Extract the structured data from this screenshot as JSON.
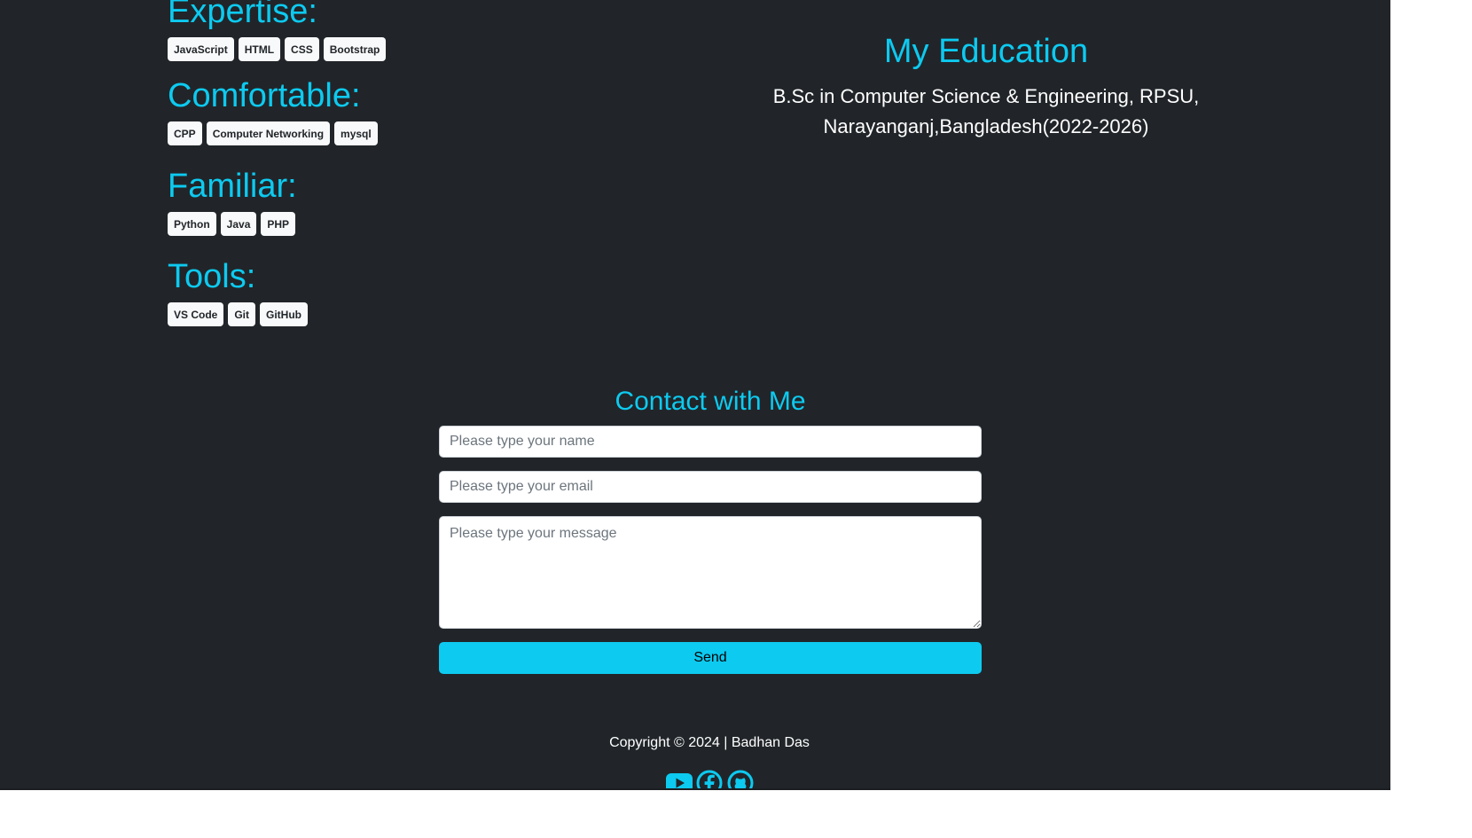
{
  "skills": {
    "expertise": {
      "heading": "Expertise:",
      "badges": [
        "JavaScript",
        "HTML",
        "CSS",
        "Bootstrap"
      ]
    },
    "comfortable": {
      "heading": "Comfortable:",
      "badges": [
        "CPP",
        "Computer Networking",
        "mysql"
      ]
    },
    "familiar": {
      "heading": "Familiar:",
      "badges": [
        "Python",
        "Java",
        "PHP"
      ]
    },
    "tools": {
      "heading": "Tools:",
      "badges": [
        "VS Code",
        "Git",
        "GitHub"
      ]
    }
  },
  "education": {
    "title": "My Education",
    "line1": "B.Sc in Computer Science & Engineering, RPSU,",
    "line2": "Narayanganj,Bangladesh(2022-2026)"
  },
  "contact": {
    "title": "Contact with Me",
    "name_placeholder": "Please type your name",
    "email_placeholder": "Please type your email",
    "message_placeholder": "Please type your message",
    "send_label": "Send"
  },
  "footer": {
    "copyright": "Copyright © 2024 | Badhan Das",
    "social_icons": [
      "youtube-icon",
      "facebook-icon",
      "github-icon"
    ]
  },
  "colors": {
    "background": "#212529",
    "accent": "#0dcaf0",
    "badge_bg": "#f8f9fa",
    "text": "#ffffff"
  }
}
